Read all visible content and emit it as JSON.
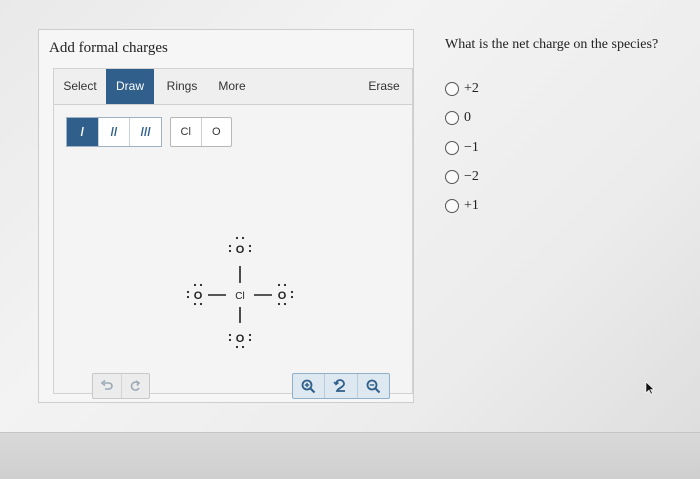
{
  "panel": {
    "title": "Add formal charges"
  },
  "tabs": [
    {
      "label": "Select"
    },
    {
      "label": "Draw",
      "active": true
    },
    {
      "label": "Rings"
    },
    {
      "label": "More"
    },
    {
      "label": "Erase"
    }
  ],
  "bond_tools": [
    {
      "label": "/",
      "active": true
    },
    {
      "label": "//"
    },
    {
      "label": "///"
    }
  ],
  "atom_tools": [
    {
      "label": "Cl"
    },
    {
      "label": "O"
    }
  ],
  "molecule": {
    "center": "Cl",
    "top": "O",
    "left": "O",
    "right": "O",
    "bottom": "O"
  },
  "history_tools": [
    "undo-icon",
    "redo-icon"
  ],
  "zoom_tools": [
    "zoom-in-icon",
    "reset-icon",
    "zoom-out-icon"
  ],
  "question": {
    "prompt": "What is the net charge on the species?",
    "options": [
      "+2",
      "0",
      "−1",
      "−2",
      "+1"
    ]
  },
  "colors": {
    "accent": "#2f5f8a",
    "zoom_bg": "#dde8f1"
  }
}
